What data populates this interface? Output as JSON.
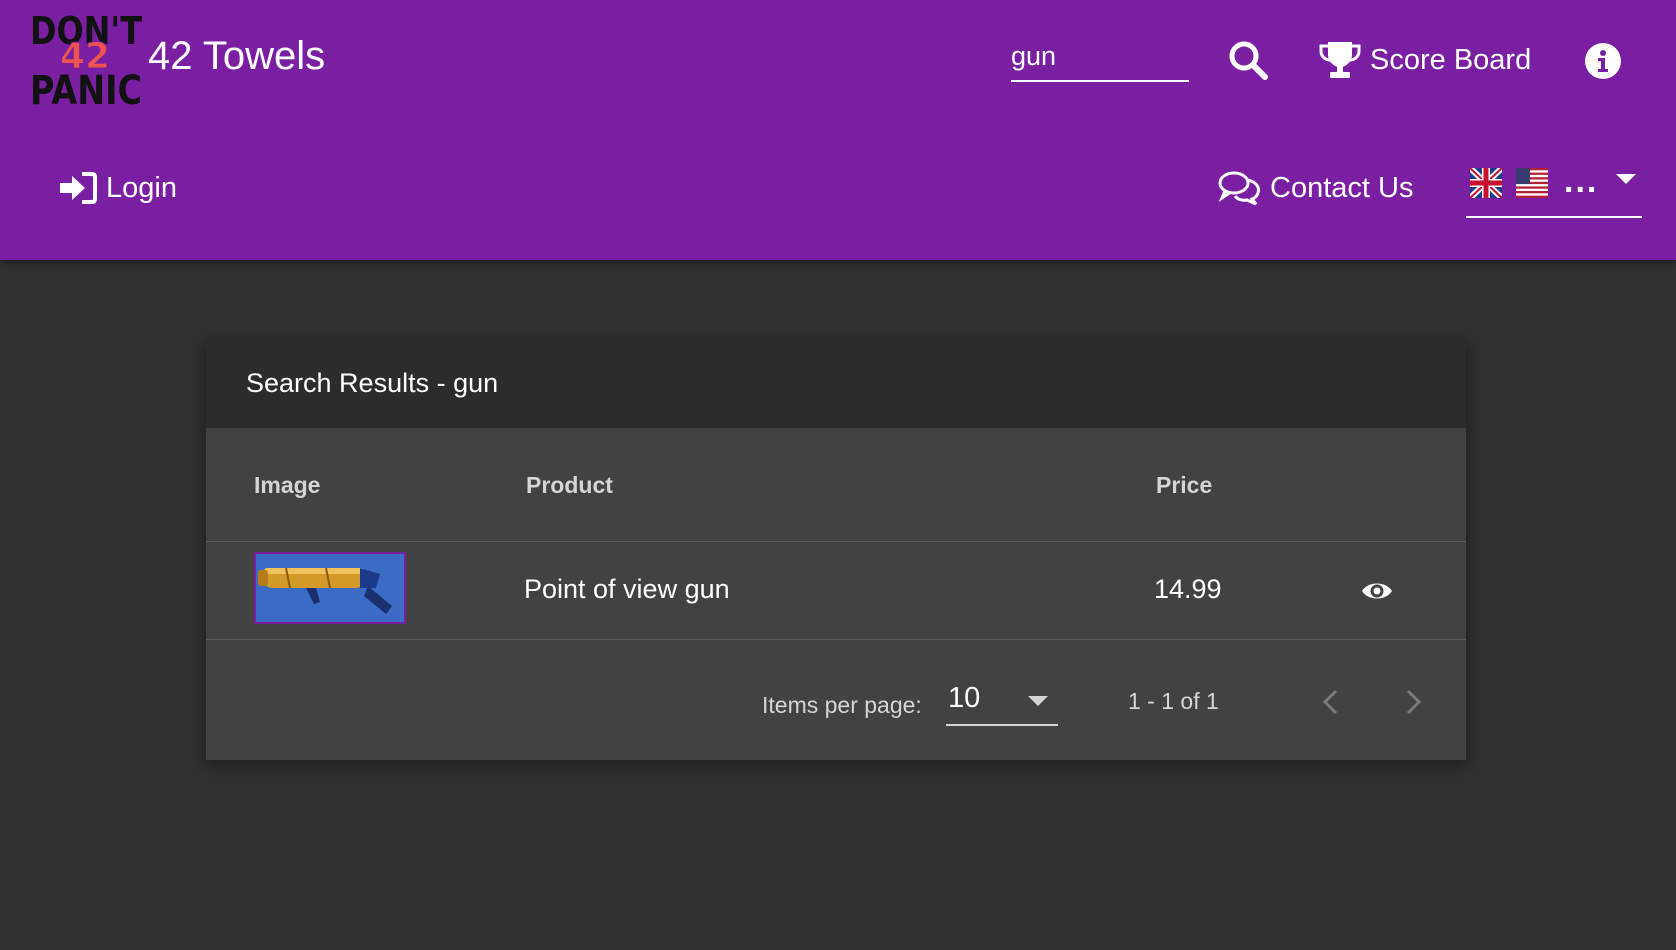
{
  "header": {
    "logo_text": [
      "DON'T",
      "42",
      "PANIC"
    ],
    "app_name": "42 Towels",
    "search": {
      "value": "gun",
      "icon": "search-icon"
    },
    "score_board_label": "Score Board",
    "login_label": "Login",
    "contact_label": "Contact Us",
    "language": {
      "flags": [
        "uk-flag",
        "us-flag"
      ],
      "ellipsis": "..."
    }
  },
  "results": {
    "title": "Search Results - gun",
    "columns": [
      "Image",
      "Product",
      "Price"
    ],
    "rows": [
      {
        "product": "Point of view gun",
        "price": "14.99"
      }
    ],
    "paginator": {
      "items_per_page_label": "Items per page:",
      "items_per_page_value": "10",
      "range_label": "1 - 1 of 1"
    }
  },
  "colors": {
    "toolbar": "#7b1fa2",
    "background": "#303030",
    "card": "#424242",
    "card_header": "#2c2c2c"
  }
}
